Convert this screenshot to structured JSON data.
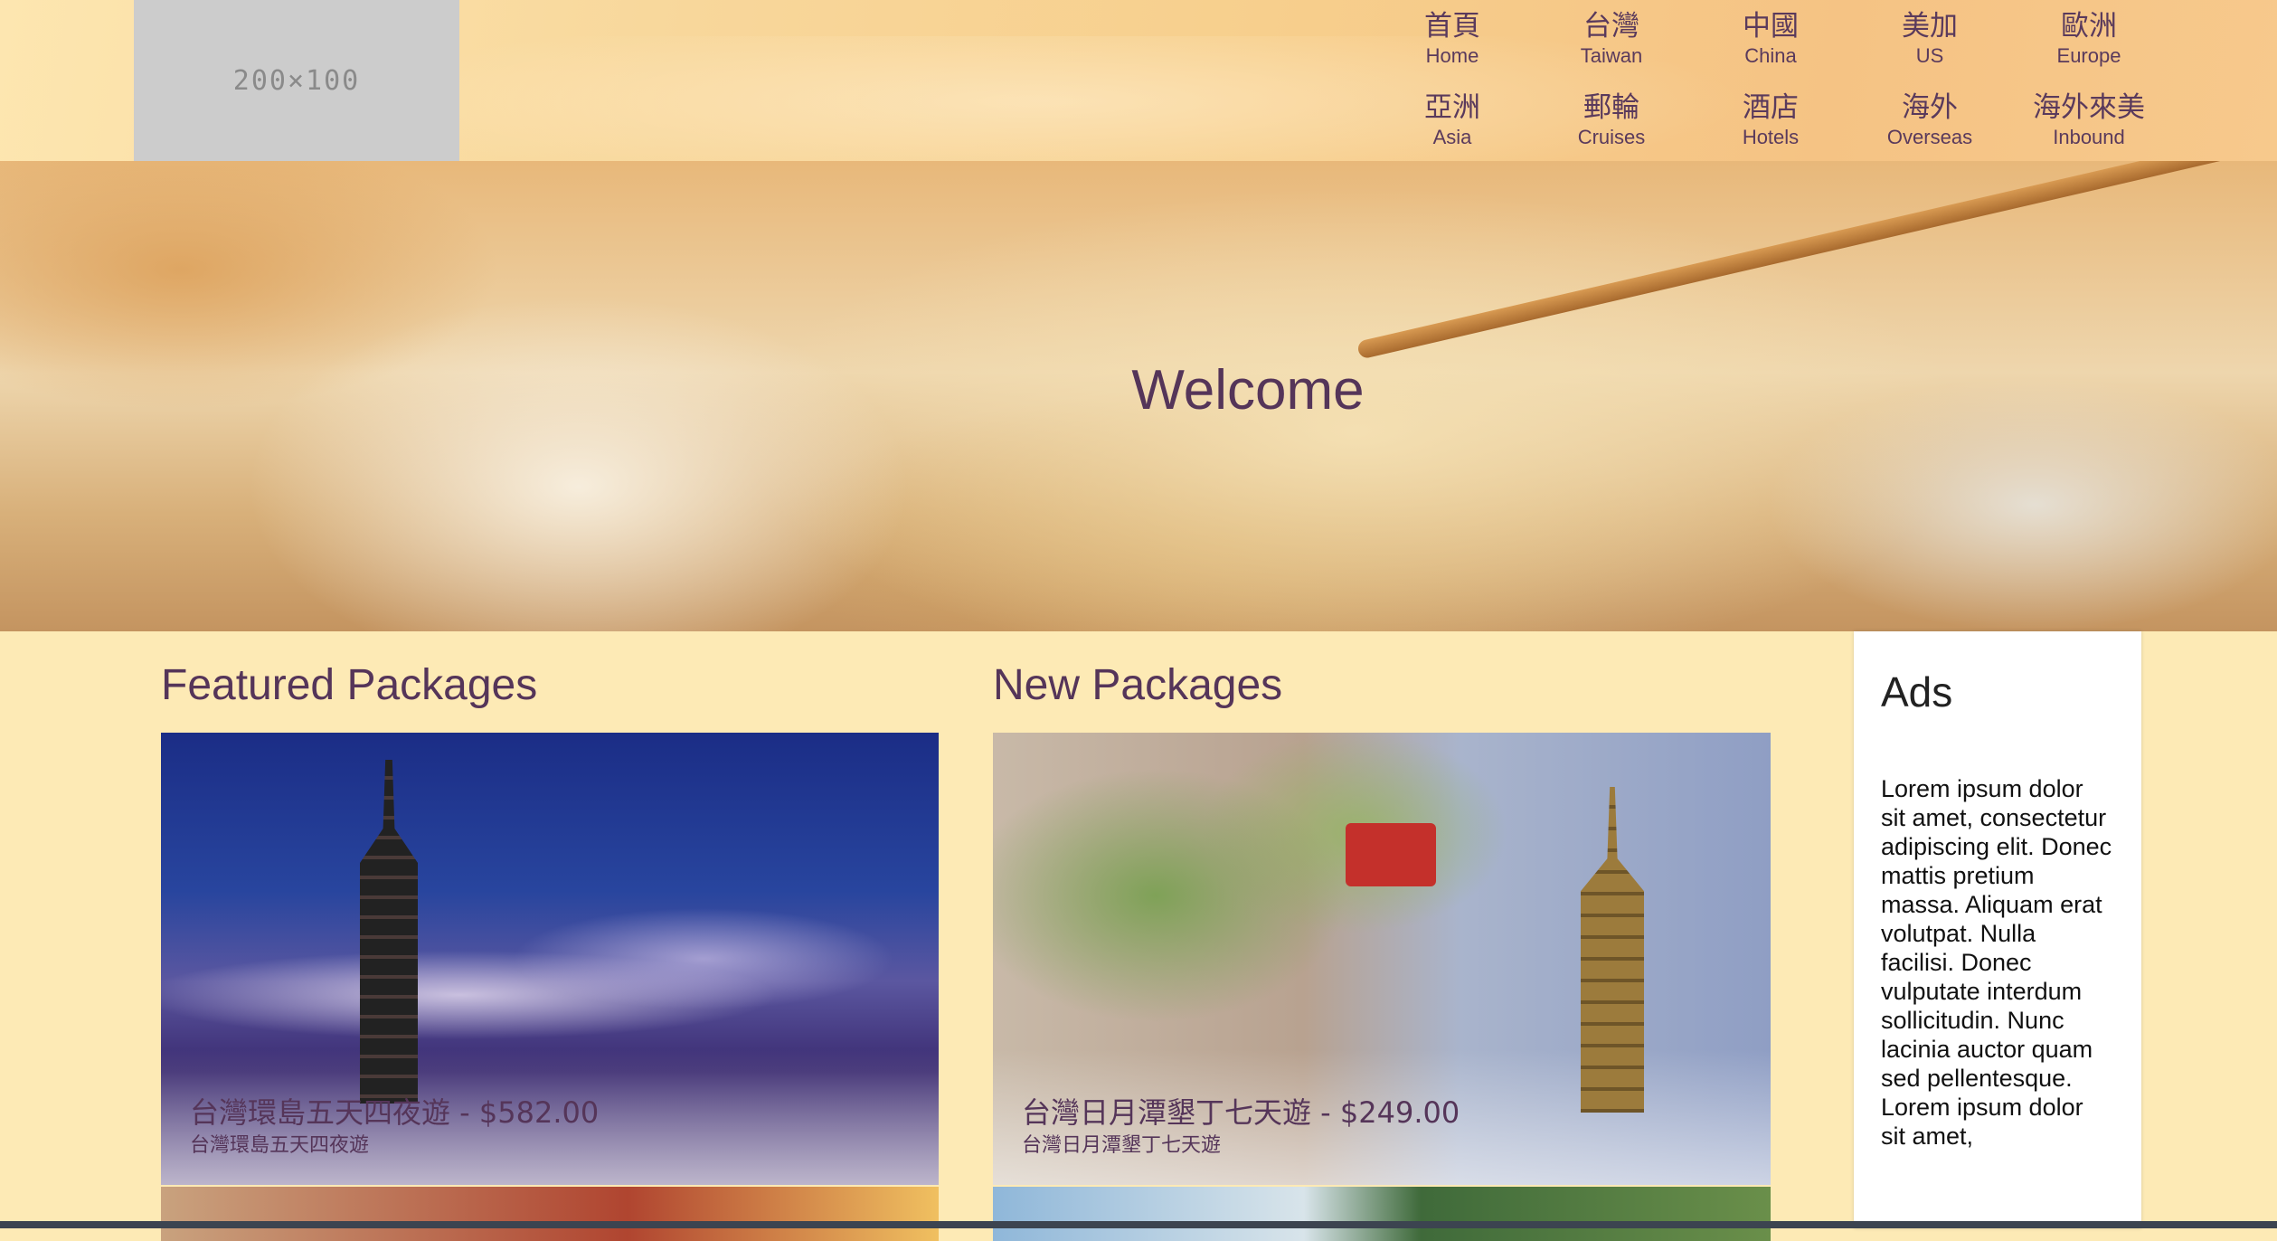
{
  "logo": {
    "text": "200×100"
  },
  "nav": {
    "items": [
      {
        "zh": "首頁",
        "en": "Home"
      },
      {
        "zh": "台灣",
        "en": "Taiwan"
      },
      {
        "zh": "中國",
        "en": "China"
      },
      {
        "zh": "美加",
        "en": "US"
      },
      {
        "zh": "歐洲",
        "en": "Europe"
      },
      {
        "zh": "亞洲",
        "en": "Asia"
      },
      {
        "zh": "郵輪",
        "en": "Cruises"
      },
      {
        "zh": "酒店",
        "en": "Hotels"
      },
      {
        "zh": "海外",
        "en": "Overseas"
      },
      {
        "zh": "海外來美",
        "en": "Inbound"
      }
    ]
  },
  "hero": {
    "title": "Welcome"
  },
  "featured": {
    "heading": "Featured Packages",
    "card": {
      "title": "台灣環島五天四夜遊 - $582.00",
      "subtitle": "台灣環島五天四夜遊"
    }
  },
  "new_packages": {
    "heading": "New Packages",
    "card": {
      "title": "台灣日月潭墾丁七天遊 - $249.00",
      "subtitle": "台灣日月潭墾丁七天遊"
    }
  },
  "ads": {
    "title": "Ads",
    "text": "Lorem ipsum dolor sit amet, consectetur adipiscing elit. Donec mattis pretium massa. Aliquam erat volutpat. Nulla facilisi. Donec vulputate interdum sollicitudin. Nunc lacinia auctor quam sed pellentesque. Lorem ipsum dolor sit amet,"
  },
  "colors": {
    "accent_text": "#553559",
    "page_background": "#fdeab5",
    "logo_placeholder": "#cccccc"
  }
}
